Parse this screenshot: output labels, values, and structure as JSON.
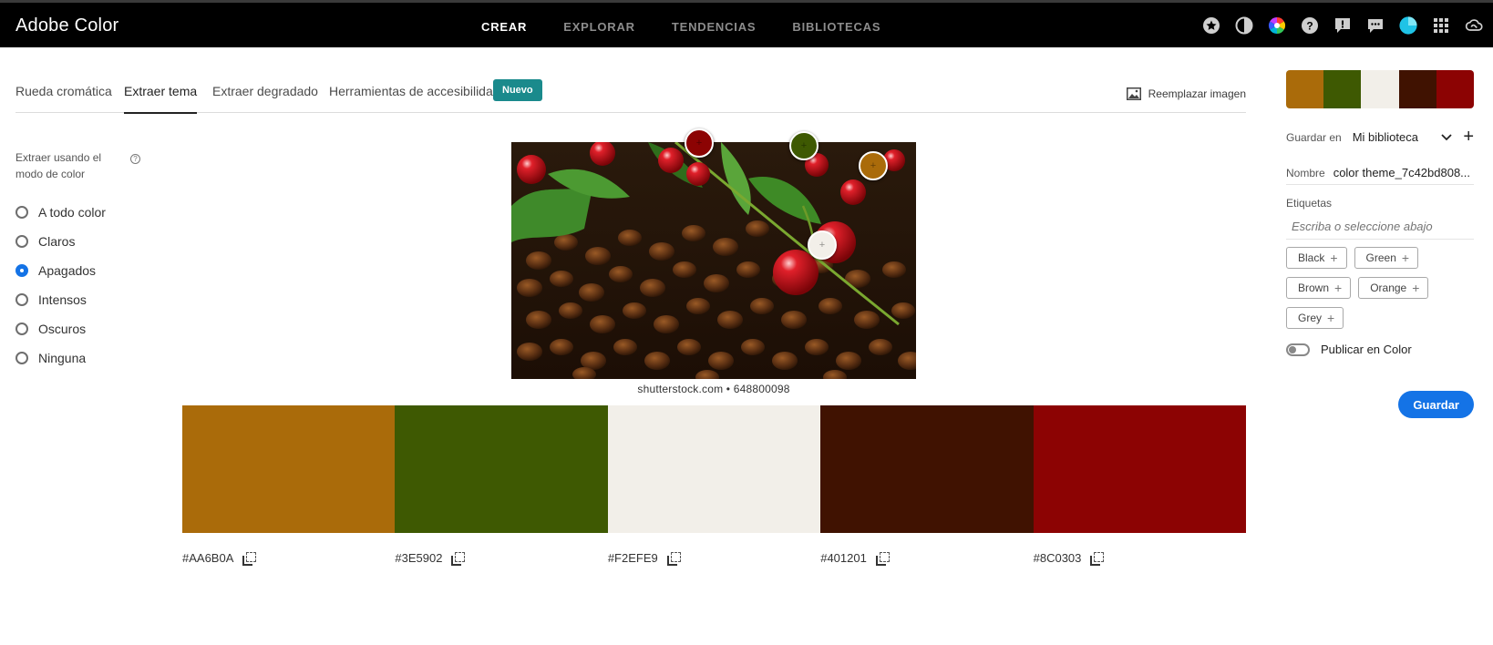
{
  "app": {
    "title": "Adobe Color"
  },
  "nav": {
    "items": [
      "CREAR",
      "EXPLORAR",
      "TENDENCIAS",
      "BIBLIOTECAS"
    ]
  },
  "top_icons": [
    "star-icon",
    "contrast-icon",
    "color-wheel-icon",
    "help-icon",
    "alert-icon",
    "comments-icon",
    "avatar-icon",
    "apps-grid-icon",
    "creative-cloud-icon"
  ],
  "subtabs": [
    "Rueda cromática",
    "Extraer tema",
    "Extraer degradado",
    "Herramientas de accesibilidad"
  ],
  "badge": "Nuevo",
  "replace_image": "Reemplazar imagen",
  "mode": {
    "label": "Extraer usando el modo de color",
    "options": [
      "A todo color",
      "Claros",
      "Apagados",
      "Intensos",
      "Oscuros",
      "Ninguna"
    ],
    "selected": "Apagados"
  },
  "image": {
    "credit": "shutterstock.com • 648800098"
  },
  "colors": [
    {
      "hex": "#AA6B0A"
    },
    {
      "hex": "#3E5902"
    },
    {
      "hex": "#F2EFE9"
    },
    {
      "hex": "#401201"
    },
    {
      "hex": "#8C0303"
    }
  ],
  "save_panel": {
    "save_to_label": "Guardar en",
    "library": "Mi biblioteca",
    "name_label": "Nombre",
    "name_value": "color theme_7c42bd808...",
    "tags_label": "Etiquetas",
    "tags_placeholder": "Escriba o seleccione abajo",
    "tags": [
      "Black",
      "Green",
      "Brown",
      "Orange",
      "Grey"
    ],
    "publish_label": "Publicar en Color",
    "publish_on": false,
    "save_button": "Guardar"
  }
}
